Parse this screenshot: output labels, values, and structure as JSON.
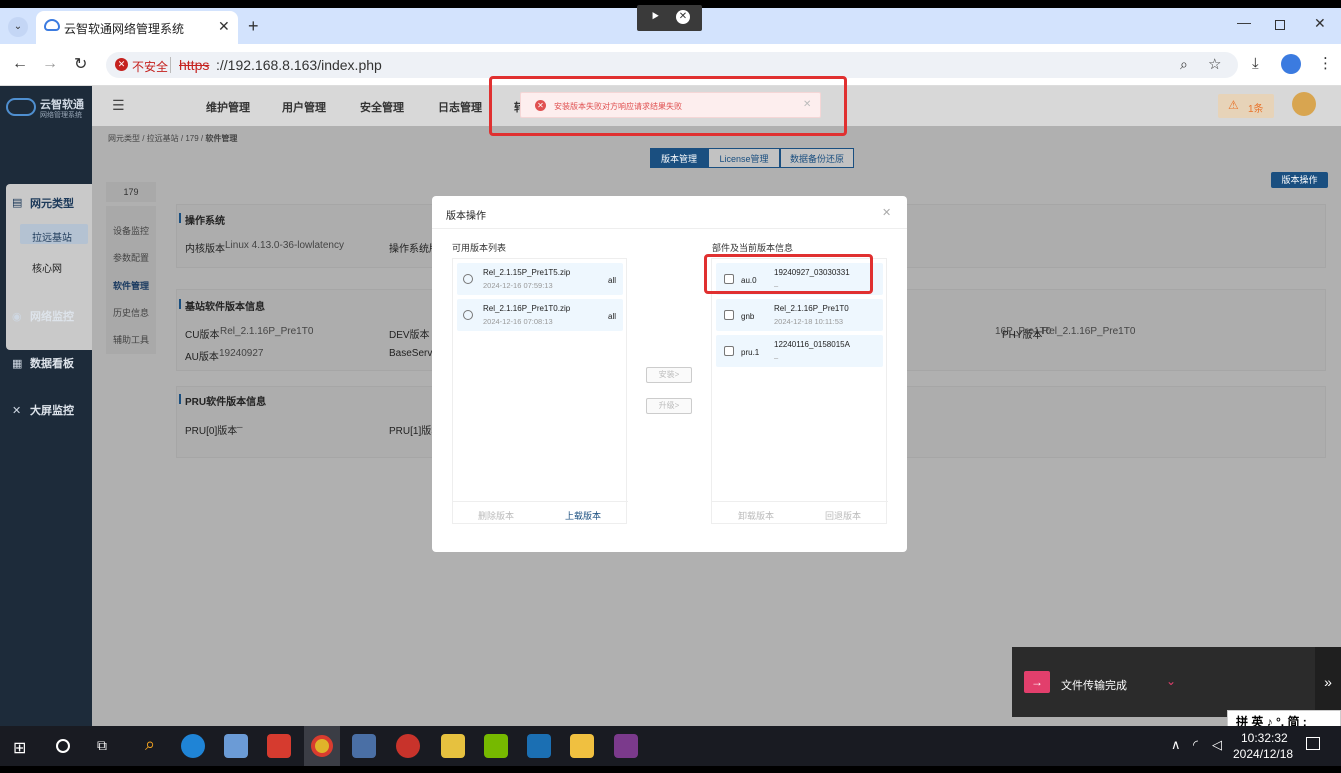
{
  "browser": {
    "tab_title": "云智软通网络管理系统",
    "insecure_label": "不安全",
    "url_scheme": "https",
    "url_rest": "://192.168.8.163/index.php"
  },
  "app": {
    "logo_title": "云智软通",
    "logo_subtitle": "网络管理系统",
    "sidebar": [
      {
        "label": "网元类型",
        "children": [
          "拉远基站",
          "核心网"
        ]
      },
      {
        "label": "网络监控"
      },
      {
        "label": "数据看板"
      },
      {
        "label": "大屏监控"
      }
    ],
    "top_menu": [
      "维护管理",
      "用户管理",
      "安全管理",
      "日志管理",
      "转"
    ],
    "alarm_count": "1条",
    "breadcrumb": [
      "网元类型",
      "拉远基站",
      "179",
      "软件管理"
    ],
    "tabs": [
      "版本管理",
      "License管理",
      "数据备份还原"
    ],
    "version_op_button": "版本操作",
    "device_id": "179",
    "left_nav": [
      "设备监控",
      "参数配置",
      "软件管理",
      "历史信息",
      "辅助工具"
    ],
    "os_section": {
      "title": "操作系统",
      "kernel_label": "内核版本",
      "kernel_value": "Linux 4.13.0-36-lowlatency",
      "os_label": "操作系统版"
    },
    "bs_section": {
      "title": "基站软件版本信息",
      "cu_label": "CU版本",
      "cu_value": "Rel_2.1.16P_Pre1T0",
      "dev_label": "DEV版本",
      "mid_value": "16P_Pre1T0",
      "phy_label": "PHY版本",
      "phy_value": "Rel_2.1.16P_Pre1T0",
      "au_label": "AU版本",
      "au_value": "19240927",
      "base_label": "BaseServi"
    },
    "pru_section": {
      "title": "PRU软件版本信息",
      "pru0_label": "PRU[0]版本",
      "pru0_value": "–",
      "pru1_label": "PRU[1]版本"
    }
  },
  "toast": {
    "message": "安装版本失败对方响应请求结果失败"
  },
  "modal": {
    "title": "版本操作",
    "left_title": "可用版本列表",
    "right_title": "部件及当前版本信息",
    "available": [
      {
        "name": "Rel_2.1.15P_Pre1T5.zip",
        "date": "2024-12-16 07:59:13",
        "tag": "all"
      },
      {
        "name": "Rel_2.1.16P_Pre1T0.zip",
        "date": "2024-12-16 07:08:13",
        "tag": "all"
      }
    ],
    "components": [
      {
        "name": "au.0",
        "version": "19240927_03030331",
        "date": "–"
      },
      {
        "name": "gnb",
        "version": "Rel_2.1.16P_Pre1T0",
        "date": "2024-12-18 10:11:53"
      },
      {
        "name": "pru.1",
        "version": "12240116_0158015A",
        "date": "–"
      }
    ],
    "install_button": "安装>",
    "upgrade_button": "升级>",
    "delete_button": "删除版本",
    "upload_button": "上载版本",
    "uninstall_button": "卸载版本",
    "rollback_button": "回退版本"
  },
  "notification": {
    "text": "文件传输完成"
  },
  "ime": {
    "text": "拼 英 ♪ °, 简 :"
  },
  "taskbar": {
    "time": "10:32:32",
    "date": "2024/12/18"
  },
  "colors": {
    "accent": "#1a5a9a",
    "danger": "#e03030",
    "sidebar_bg": "#1d2b3a"
  }
}
